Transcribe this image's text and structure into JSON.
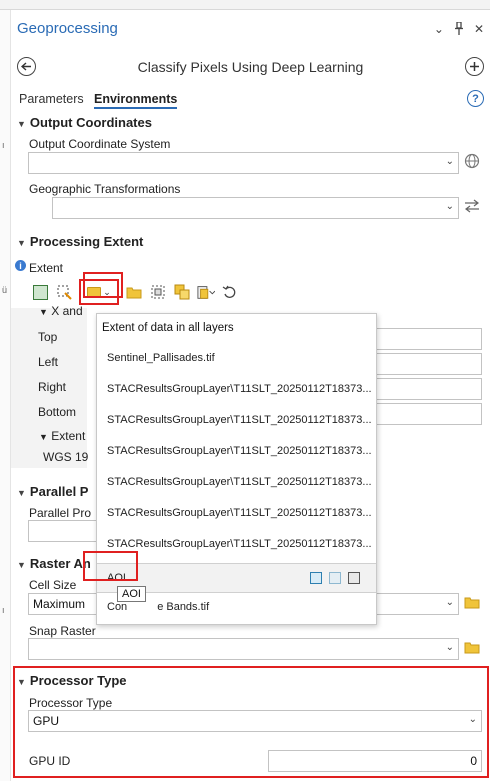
{
  "panel": {
    "title": "Geoprocessing",
    "controls": {
      "dropdown": "⌄",
      "pin": "ᴉ",
      "close": "✕"
    },
    "tool_title": "Classify Pixels Using Deep Learning",
    "tabs": [
      "Parameters",
      "Environments"
    ],
    "active_tab": "Environments",
    "help": "?"
  },
  "output_coordinates": {
    "heading": "Output Coordinates",
    "ocs_label": "Output Coordinate System",
    "ocs_value": "",
    "geo_label": "Geographic Transformations",
    "geo_value": ""
  },
  "processing_extent": {
    "heading": "Processing Extent",
    "extent_label": "Extent",
    "sub_xy": "X and",
    "top_label": "Top",
    "left_label": "Left",
    "right_label": "Right",
    "bottom_label": "Bottom",
    "extent_sub": "Extent",
    "wgs": "WGS 19"
  },
  "extent_menu": {
    "header": "Extent of data in all layers",
    "items": [
      "Sentinel_Pallisades.tif",
      "STACResultsGroupLayer\\T11SLT_20250112T18373...",
      "STACResultsGroupLayer\\T11SLT_20250112T18373...",
      "STACResultsGroupLayer\\T11SLT_20250112T18373...",
      "STACResultsGroupLayer\\T11SLT_20250112T18373...",
      "STACResultsGroupLayer\\T11SLT_20250112T18373...",
      "STACResultsGroupLayer\\T11SLT_20250112T18373..."
    ],
    "selected": "AOI",
    "last_item_a": "Con",
    "last_item_b": "e Bands.tif",
    "tooltip": "AOI"
  },
  "parallel": {
    "heading": "Parallel P",
    "label": "Parallel Pro"
  },
  "raster": {
    "heading": "Raster An",
    "cell_size_label": "Cell Size",
    "cell_size_value": "Maximum",
    "snap_label": "Snap Raster",
    "snap_value": ""
  },
  "processor": {
    "heading": "Processor Type",
    "type_label": "Processor Type",
    "type_value": "GPU",
    "gpu_label": "GPU ID",
    "gpu_value": "0"
  },
  "left_edge_marks": [
    "ı",
    "ü",
    "ı"
  ]
}
